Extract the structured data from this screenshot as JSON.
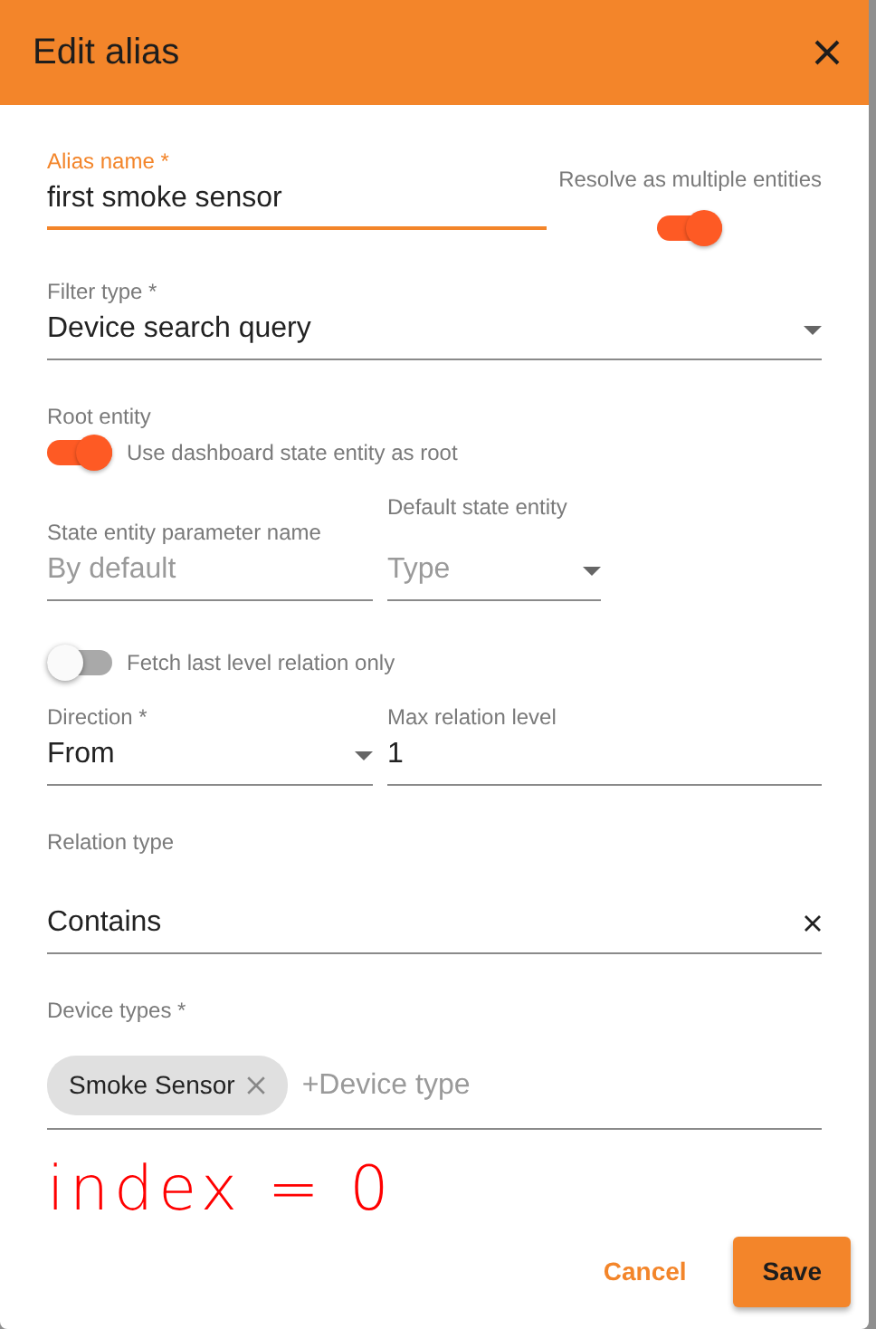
{
  "dialog": {
    "title": "Edit alias"
  },
  "alias_name": {
    "label": "Alias name *",
    "value": "first smoke sensor",
    "focused": true
  },
  "resolve_multiple": {
    "label": "Resolve as multiple entities",
    "on": true
  },
  "filter_type": {
    "label": "Filter type *",
    "value": "Device search query"
  },
  "root_entity": {
    "label": "Root entity",
    "toggle_label": "Use dashboard state entity as root",
    "on": true
  },
  "state_entity_param": {
    "label": "State entity parameter name",
    "placeholder": "By default"
  },
  "default_state_entity": {
    "label": "Default state entity",
    "placeholder": "Type"
  },
  "fetch_last_level": {
    "label": "Fetch last level relation only",
    "on": false
  },
  "direction": {
    "label": "Direction *",
    "value": "From"
  },
  "max_relation_level": {
    "label": "Max relation level",
    "value": "1"
  },
  "relation_type": {
    "label": "Relation type",
    "value": "Contains"
  },
  "device_types": {
    "label": "Device types *",
    "chips": [
      {
        "label": "Smoke Sensor"
      }
    ],
    "placeholder": "+Device type"
  },
  "annotation": {
    "text": "index = 0"
  },
  "buttons": [
    {
      "label": "Cancel",
      "kind": "text"
    },
    {
      "label": "Save",
      "kind": "raised"
    }
  ]
}
